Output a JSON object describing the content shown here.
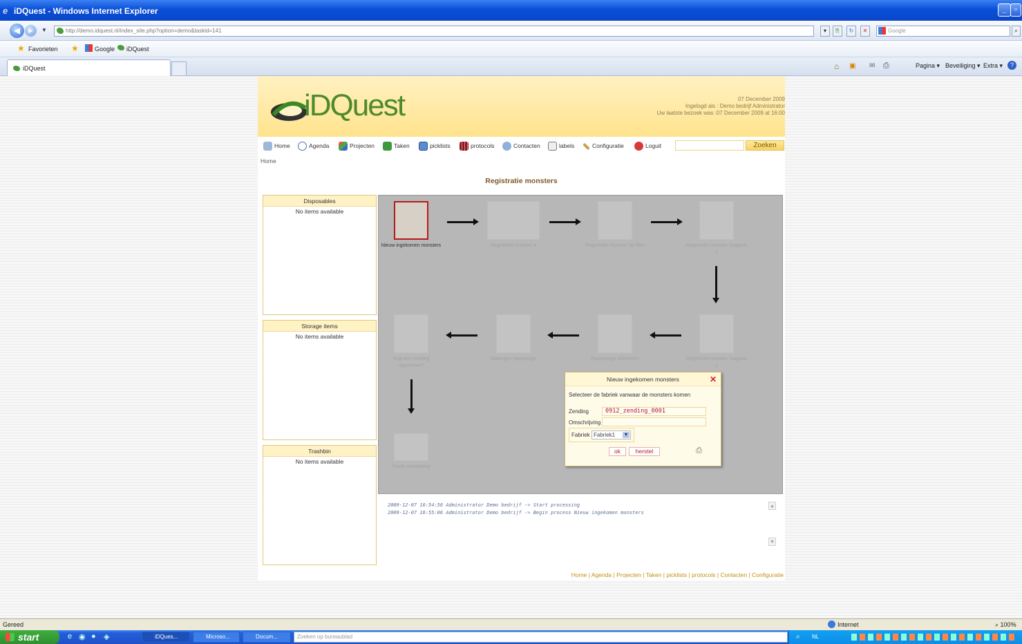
{
  "window": {
    "title": "iDQuest - Windows Internet Explorer"
  },
  "addressbar": {
    "url": "http://demo.idquest.nl/index_site.php?option=demo&taskid=141",
    "search_placeholder": "Google"
  },
  "favbar": {
    "favorites_label": "Favorieten",
    "links": [
      "Google",
      "iDQuest"
    ]
  },
  "tab": {
    "label": "iDQuest"
  },
  "toolbar_right": {
    "page_label": "Pagina",
    "security_label": "Beveiliging",
    "extra_label": "Extra"
  },
  "header": {
    "logo_text": "iDQuest",
    "date": "07 December 2009",
    "logged_in": "Ingelogd als : Demo bedrijf Administrator",
    "last_visit": "Uw laatste bezoek was :07 December 2009 at 16:00"
  },
  "nav": {
    "items": [
      "Home",
      "Agenda",
      "Projecten",
      "Taken",
      "picklists",
      "protocols",
      "Contacten",
      "labels",
      "Configuratie",
      "Loguit"
    ],
    "search_button": "Zoeken"
  },
  "breadcrumb": "Home",
  "page_title": "Registratie monsters",
  "sideboxes": [
    {
      "title": "Disposables",
      "empty": "No items available"
    },
    {
      "title": "Storage items",
      "empty": "No items available"
    },
    {
      "title": "Trashbin",
      "empty": "No items available"
    }
  ],
  "workflow": {
    "steps": [
      "Nieuw ingekomen monsters",
      "Registratie monster",
      "Registratie monster Na filter",
      "Registratie monster Dagtank 1",
      "Registratie monster Dagtank 2",
      "Rapportage afdrukken",
      "Opbergen rapportage",
      "Nog een zending registreren?",
      "Einde verwerking"
    ]
  },
  "dialog": {
    "title": "Nieuw ingekomen monsters",
    "instruction": "Selecteer de fabriek vanwaar de monsters komen",
    "zending_label": "Zending",
    "zending_value": "0912_zending_0001",
    "omschrijving_label": "Omschrijving",
    "omschrijving_value": "",
    "fabriek_label": "Fabriek",
    "fabriek_value": "Fabriek1",
    "ok_label": "ok",
    "reset_label": "herstel"
  },
  "log": [
    "2009-12-07 16:54:56 Administrator Demo bedrijf -> Start processing",
    "2009-12-07 16:55:06 Administrator Demo bedrijf -> Begin process Nieuw ingekomen monsters"
  ],
  "footer": "Home | Agenda | Projecten | Taken | picklists | protocols | Contacten | Configuratie",
  "statusbar": {
    "left": "Gereed",
    "zone": "Internet",
    "zoom": "100%"
  },
  "taskbar": {
    "start": "start",
    "tasks": [
      "iDQues...",
      "Microso...",
      "Docum..."
    ],
    "search_placeholder": "Zoeken op bureaublad",
    "lang": "NL"
  },
  "colors": {
    "header": "#ffe38d",
    "accent": "#7d5a2a",
    "workflow_bg": "#b7b7b7"
  }
}
